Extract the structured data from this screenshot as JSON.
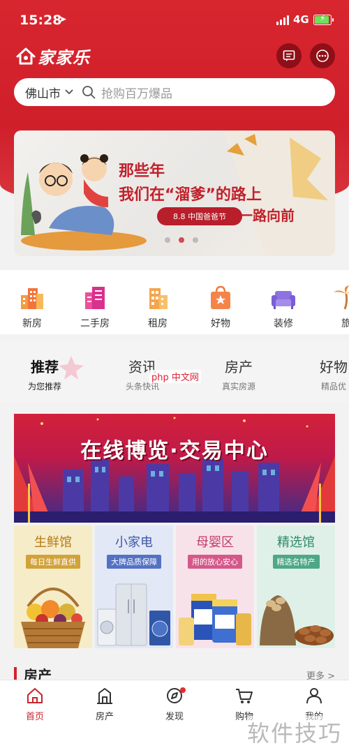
{
  "status_bar": {
    "time": "15:28",
    "network": "4G"
  },
  "header": {
    "logo_text": "家家乐"
  },
  "search": {
    "city": "佛山市",
    "placeholder": "抢购百万爆品"
  },
  "banner": {
    "line1": "那些年",
    "line2": "我们在“溜爹”的路上",
    "line3": "一路向前",
    "badge": "8.8 中国爸爸节",
    "slides": 3,
    "active_slide": 1
  },
  "categories": [
    {
      "label": "新房",
      "icon": "new-house-icon"
    },
    {
      "label": "二手房",
      "icon": "second-hand-house-icon"
    },
    {
      "label": "租房",
      "icon": "rent-house-icon"
    },
    {
      "label": "好物",
      "icon": "goods-bag-icon"
    },
    {
      "label": "装修",
      "icon": "sofa-icon"
    },
    {
      "label": "旅",
      "icon": "palm-tree-icon"
    }
  ],
  "tabs": [
    {
      "title": "推荐",
      "sub": "为您推荐"
    },
    {
      "title": "资讯",
      "sub": "头条快讯"
    },
    {
      "title": "房产",
      "sub": "真实房源"
    },
    {
      "title": "好物",
      "sub": "精品优"
    }
  ],
  "watermark": "php 中文网",
  "expo": {
    "title": "在线博览·交易中心"
  },
  "tiles": [
    {
      "title": "生鲜馆",
      "tag": "每日生鲜直供",
      "title_color": "#b57a12",
      "tag_color": "#d2a23a",
      "bg": "#f6ecc8"
    },
    {
      "title": "小家电",
      "tag": "大牌品质保障",
      "title_color": "#3b59a8",
      "tag_color": "#5472c4",
      "bg": "#e3e8f6"
    },
    {
      "title": "母婴区",
      "tag": "用的放心安心",
      "title_color": "#c23a68",
      "tag_color": "#d5588a",
      "bg": "#f8e2ea"
    },
    {
      "title": "精选馆",
      "tag": "精选名特产",
      "title_color": "#2f8a67",
      "tag_color": "#4ea886",
      "bg": "#dff0e8"
    }
  ],
  "section": {
    "title": "房产",
    "more": "更多 >"
  },
  "tabbar": [
    {
      "label": "首页",
      "icon": "home-icon"
    },
    {
      "label": "房产",
      "icon": "building-icon"
    },
    {
      "label": "发现",
      "icon": "compass-icon"
    },
    {
      "label": "购物",
      "icon": "cart-icon"
    },
    {
      "label": "我的",
      "icon": "user-icon"
    }
  ],
  "site_mark": "软件技巧",
  "colors": {
    "brand_red": "#d3222c",
    "active_tab": "#c8232c"
  }
}
